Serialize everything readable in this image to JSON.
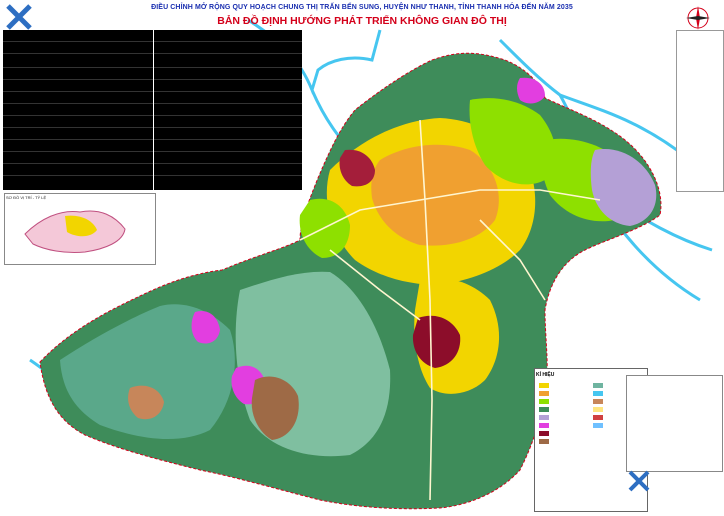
{
  "header": {
    "title_line1": "ĐIỀU CHỈNH MỞ RỘNG QUY HOẠCH CHUNG THỊ TRẤN BẾN SUNG, HUYỆN NHƯ THANH, TỈNH THANH HÓA ĐẾN NĂM 2035",
    "title_line2": "BẢN ĐỒ ĐỊNH HƯỚNG PHÁT TRIỂN KHÔNG GIAN ĐÔ THỊ"
  },
  "legend": {
    "title": "KÍ HIỆU"
  },
  "inset": {
    "label": "SƠ ĐỒ VỊ TRÍ - TỶ LỆ"
  },
  "colors": {
    "river": "#46c6f0",
    "forest": "#3e8c5a",
    "agriculture": "#6fb4a0",
    "residential": "#f2d500",
    "urban_core": "#f0a030",
    "green_park": "#8ee000",
    "industry": "#b4a0d6",
    "military": "#8c0d2a",
    "special": "#e23ee0",
    "brown_land": "#9e6a46",
    "boundary": "#d4001a"
  },
  "icons": [
    "logo-icon",
    "compass-icon"
  ]
}
